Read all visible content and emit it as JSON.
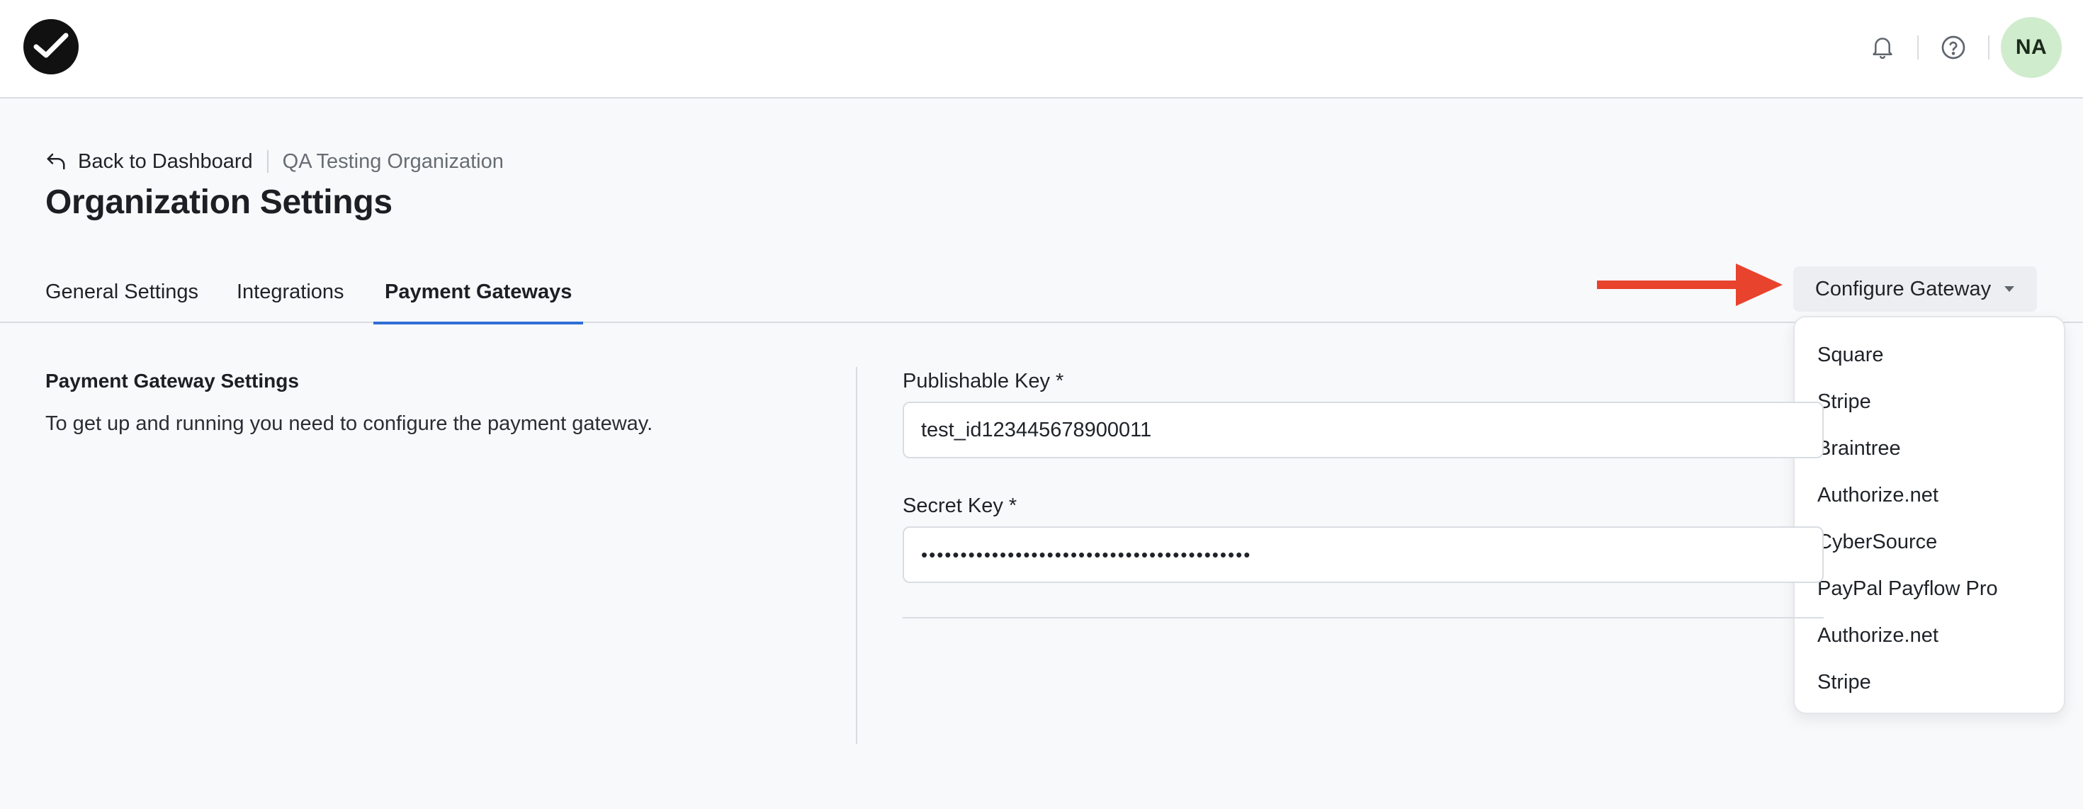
{
  "header": {
    "logo_icon": "check-logo-icon",
    "notification_icon": "bell-icon",
    "help_icon": "help-circle-icon",
    "avatar_initials": "NA",
    "avatar_color": "#cfeccd"
  },
  "breadcrumb": {
    "back_label": "Back to Dashboard",
    "back_icon": "undo-arrow-icon",
    "organization": "QA Testing Organization"
  },
  "page": {
    "title": "Organization Settings"
  },
  "tabs": [
    {
      "label": "General Settings",
      "active": false
    },
    {
      "label": "Integrations",
      "active": false
    },
    {
      "label": "Payment Gateways",
      "active": true
    }
  ],
  "gateway": {
    "configure_label": "Configure Gateway",
    "menu_items": [
      "Square",
      "Stripe",
      "Braintree",
      "Authorize.net",
      "CyberSource",
      "PayPal Payflow Pro",
      "Authorize.net",
      "Stripe"
    ]
  },
  "settings": {
    "section_title": "Payment Gateway Settings",
    "section_description": "To get up and running you need to configure the payment gateway.",
    "publishable_key_label": "Publishable Key *",
    "publishable_key_value": "test_id123445678900011",
    "secret_key_label": "Secret Key *",
    "secret_key_value": "••••••••••••••••••••••••••••••••••••••••••"
  },
  "colors": {
    "accent": "#2f6fd6",
    "annotation_arrow": "#e8432d"
  }
}
